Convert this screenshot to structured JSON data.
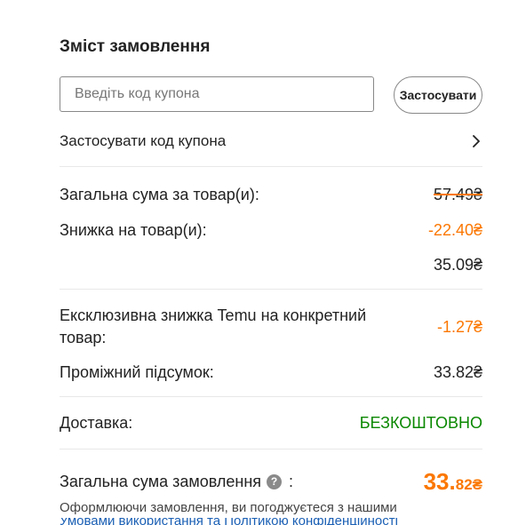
{
  "summary": {
    "title": "Зміст замовлення",
    "coupon_placeholder": "Введіть код купона",
    "apply_label": "Застосувати",
    "coupon_link_label": "Застосувати код купона"
  },
  "rows": {
    "items_total": {
      "label": "Загальна сума за товар(и):",
      "value": "57.49₴"
    },
    "items_discount": {
      "label": "Знижка на товар(и):",
      "value": "-22.40₴"
    },
    "after_discount": {
      "value": "35.09₴"
    },
    "exclusive_discount": {
      "label": "Ексклюзивна знижка Temu на конкретний товар:",
      "value": "-1.27₴"
    },
    "subtotal": {
      "label": "Проміжний підсумок:",
      "value": "33.82₴"
    },
    "shipping": {
      "label": "Доставка:",
      "value": "БЕЗКОШТОВНО"
    },
    "order_total": {
      "label": "Загальна сума замовлення",
      "colon": ":",
      "value_int": "33.",
      "value_dec": "82₴"
    }
  },
  "terms": {
    "text": "Оформлюючи замовлення, ви погоджуєтеся з нашими",
    "link_text": "Умовами використання та Політикою конфіденційності"
  },
  "colors": {
    "accent": "#fb7701",
    "free_shipping": "#0a8800",
    "link": "#1a5fb4"
  },
  "icons": {
    "chevron": "chevron-right-icon",
    "help": "help-circle-icon"
  }
}
